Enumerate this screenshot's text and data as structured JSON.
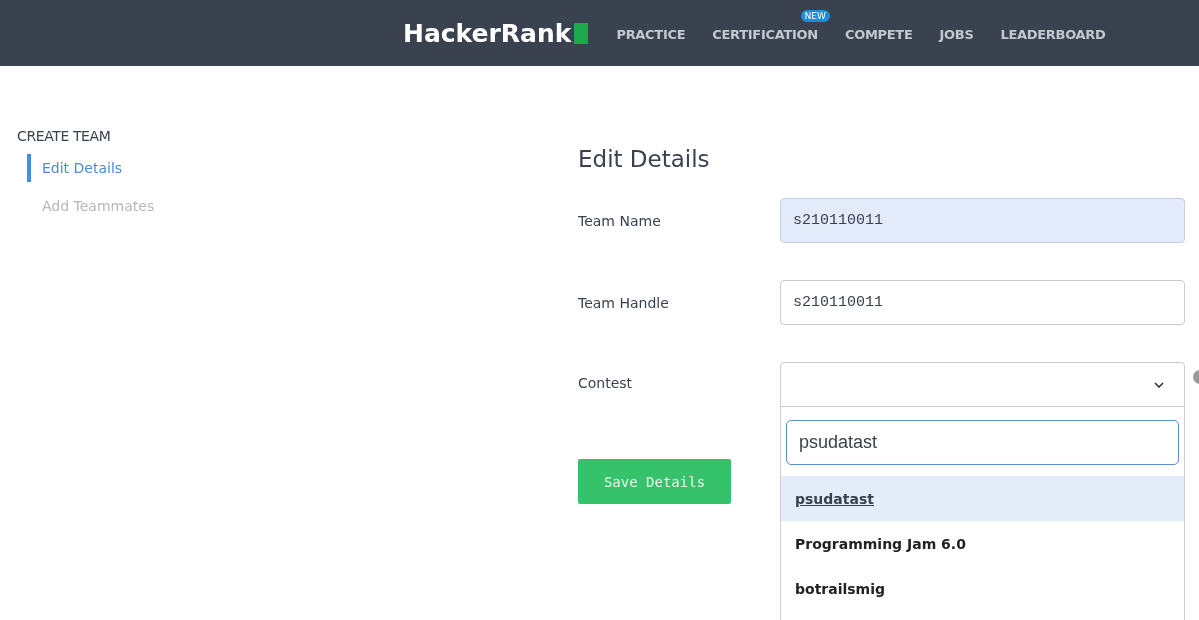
{
  "navbar": {
    "logo": "HackerRank",
    "items": [
      {
        "label": "PRACTICE"
      },
      {
        "label": "CERTIFICATION",
        "badge": "NEW"
      },
      {
        "label": "COMPETE"
      },
      {
        "label": "JOBS"
      },
      {
        "label": "LEADERBOARD"
      }
    ]
  },
  "sidebar": {
    "title": "CREATE TEAM",
    "items": [
      {
        "label": "Edit Details",
        "selected": true
      },
      {
        "label": "Add Teammates",
        "selected": false
      }
    ]
  },
  "form": {
    "heading": "Edit Details",
    "fields": [
      {
        "label": "Team Name",
        "value": "s210110011",
        "autofilled": true
      },
      {
        "label": "Team Handle",
        "value": "s210110011",
        "autofilled": false
      }
    ],
    "contest": {
      "label": "Contest",
      "expanded": true,
      "search": "psudatast",
      "options": [
        {
          "label": "psudatast",
          "selected": true
        },
        {
          "label": "Programming Jam 6.0",
          "selected": false
        },
        {
          "label": "botrailsmig",
          "selected": false
        }
      ]
    },
    "save_button": "Save Details"
  }
}
